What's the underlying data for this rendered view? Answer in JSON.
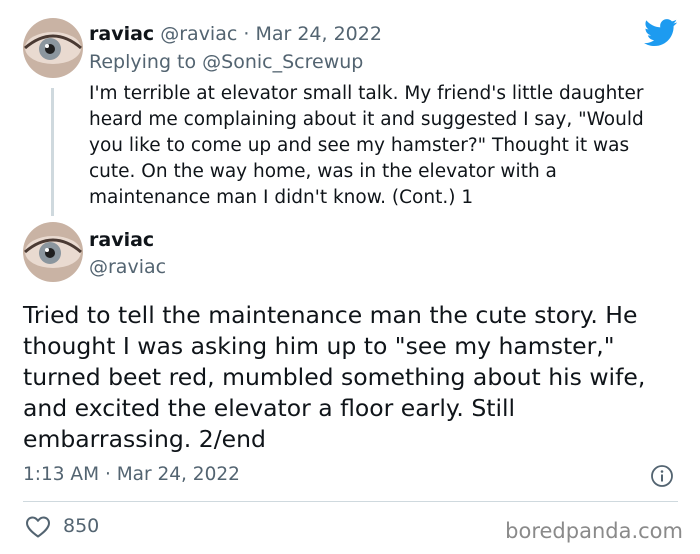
{
  "reply_tweet": {
    "display_name": "raviac",
    "handle": "@raviac",
    "separator": "·",
    "date": "Mar 24, 2022",
    "replying_prefix": "Replying to",
    "replying_to": "@Sonic_Screwup",
    "text": "I'm terrible at elevator small talk. My friend's little daughter heard me complaining about it and suggested I say, \"Would you like to come up and see my hamster?\" Thought it was cute. On the way home, was in the elevator with a maintenance man I didn't know.  (Cont.) 1"
  },
  "main_tweet": {
    "display_name": "raviac",
    "handle": "@raviac",
    "text": "Tried to tell the maintenance man the cute story. He thought I was asking him up to \"see my hamster,\" turned beet red, mumbled something about his wife, and excited the elevator a floor early. Still embarrassing.   2/end",
    "time": "1:13 AM",
    "separator": "·",
    "date": "Mar 24, 2022",
    "likes": "850"
  },
  "icons": {
    "brand": "twitter-bird-icon",
    "info": "info-icon",
    "like": "heart-icon"
  },
  "watermark": "boredpanda.com",
  "colors": {
    "brand_blue": "#1d9bf0",
    "text": "#0f1419",
    "muted": "#536471",
    "divider": "#cfd9de",
    "watermark": "#8a8a8a"
  }
}
